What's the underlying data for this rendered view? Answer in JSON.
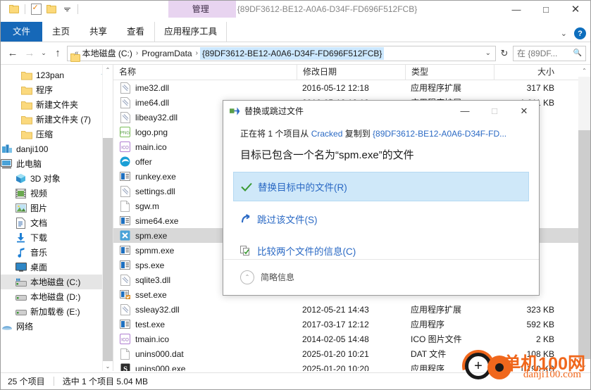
{
  "titlebar": {
    "window_title": "{89DF3612-BE12-A0A6-D34F-FD696F512FCB}",
    "context_tab": "管理",
    "quick_access": [
      {
        "name": "new-folder-icon",
        "label": ""
      },
      {
        "name": "properties-icon",
        "label": ""
      },
      {
        "name": "open-folder-icon",
        "label": ""
      },
      {
        "name": "customize-qat-icon",
        "label": ""
      }
    ],
    "minimize": "—",
    "maximize": "□",
    "close": "✕"
  },
  "ribbon": {
    "tabs": [
      {
        "label": "文件",
        "active": true
      },
      {
        "label": "主页",
        "active": false
      },
      {
        "label": "共享",
        "active": false
      },
      {
        "label": "查看",
        "active": false
      },
      {
        "label": "应用程序工具",
        "active": false
      }
    ],
    "collapse_chevron": "⌄",
    "help_label": "?"
  },
  "address": {
    "back": "←",
    "forward": "→",
    "recent": "⌄",
    "up": "↑",
    "chevrons": "«",
    "crumbs": [
      {
        "label": "本地磁盘 (C:)",
        "selected": false
      },
      {
        "label": "ProgramData",
        "selected": false
      },
      {
        "label": "{89DF3612-BE12-A0A6-D34F-FD696F512FCB}",
        "selected": true
      }
    ],
    "dropdown": "⌄",
    "refresh": "↻",
    "search_placeholder": "在 {89DF...",
    "search_icon": "🔍"
  },
  "sidebar": {
    "items": [
      {
        "label": "123pan",
        "icon": "folder-icon",
        "indent": 1,
        "pinned": true,
        "selected": false
      },
      {
        "label": "程序",
        "icon": "folder-icon",
        "indent": 1,
        "pinned": false,
        "selected": false
      },
      {
        "label": "新建文件夹",
        "icon": "folder-icon",
        "indent": 1,
        "pinned": false,
        "selected": false
      },
      {
        "label": "新建文件夹 (7)",
        "icon": "folder-icon",
        "indent": 1,
        "pinned": false,
        "selected": false
      },
      {
        "label": "压缩",
        "icon": "folder-icon",
        "indent": 1,
        "pinned": false,
        "selected": false
      },
      {
        "label": "danji100",
        "icon": "onedrive-icon",
        "indent": 0,
        "pinned": false,
        "selected": false
      },
      {
        "label": "此电脑",
        "icon": "this-pc-icon",
        "indent": 0,
        "pinned": false,
        "selected": false
      },
      {
        "label": "3D 对象",
        "icon": "3d-objects-icon",
        "indent": 2,
        "pinned": false,
        "selected": false
      },
      {
        "label": "视频",
        "icon": "videos-icon",
        "indent": 2,
        "pinned": false,
        "selected": false
      },
      {
        "label": "图片",
        "icon": "pictures-icon",
        "indent": 2,
        "pinned": false,
        "selected": false
      },
      {
        "label": "文档",
        "icon": "documents-icon",
        "indent": 2,
        "pinned": false,
        "selected": false
      },
      {
        "label": "下载",
        "icon": "downloads-icon",
        "indent": 2,
        "pinned": false,
        "selected": false
      },
      {
        "label": "音乐",
        "icon": "music-icon",
        "indent": 2,
        "pinned": false,
        "selected": false
      },
      {
        "label": "桌面",
        "icon": "desktop-icon",
        "indent": 2,
        "pinned": false,
        "selected": false
      },
      {
        "label": "本地磁盘 (C:)",
        "icon": "system-drive-icon",
        "indent": 2,
        "pinned": false,
        "selected": true
      },
      {
        "label": "本地磁盘 (D:)",
        "icon": "drive-icon",
        "indent": 2,
        "pinned": false,
        "selected": false
      },
      {
        "label": "新加载卷 (E:)",
        "icon": "drive-icon",
        "indent": 2,
        "pinned": false,
        "selected": false
      },
      {
        "label": "网络",
        "icon": "network-icon",
        "indent": 0,
        "pinned": false,
        "selected": false
      }
    ],
    "scroll_up": "⌃",
    "scroll_down": "⌄"
  },
  "filelist": {
    "columns": [
      "名称",
      "修改日期",
      "类型",
      "大小"
    ],
    "sort_indicator": "⌃",
    "rows": [
      {
        "name": "ime32.dll",
        "icon": "dll-icon",
        "date": "2016-05-12 12:18",
        "type": "应用程序扩展",
        "size": "317 KB",
        "selected": false
      },
      {
        "name": "ime64.dll",
        "icon": "dll-icon",
        "date": "2016-05-12 12:18",
        "type": "应用程序扩展",
        "size": "1,611 KB",
        "selected": false
      },
      {
        "name": "libeay32.dll",
        "icon": "dll-icon",
        "date": "",
        "type": "",
        "size": "",
        "selected": false
      },
      {
        "name": "logo.png",
        "icon": "png-icon",
        "date": "",
        "type": "",
        "size": "",
        "selected": false
      },
      {
        "name": "main.ico",
        "icon": "ico-icon",
        "date": "",
        "type": "",
        "size": "",
        "selected": false
      },
      {
        "name": "offer",
        "icon": "edge-icon",
        "date": "",
        "type": "",
        "size": "",
        "selected": false
      },
      {
        "name": "runkey.exe",
        "icon": "exe-icon",
        "date": "",
        "type": "",
        "size": "",
        "selected": false
      },
      {
        "name": "settings.dll",
        "icon": "dll-icon",
        "date": "",
        "type": "",
        "size": "",
        "selected": false
      },
      {
        "name": "sgw.m",
        "icon": "file-icon",
        "date": "",
        "type": "",
        "size": "",
        "selected": false
      },
      {
        "name": "sime64.exe",
        "icon": "exe-icon",
        "date": "",
        "type": "",
        "size": "",
        "selected": false
      },
      {
        "name": "spm.exe",
        "icon": "app-x-icon",
        "date": "",
        "type": "",
        "size": "",
        "selected": true
      },
      {
        "name": "spmm.exe",
        "icon": "exe-icon",
        "date": "",
        "type": "",
        "size": "",
        "selected": false
      },
      {
        "name": "sps.exe",
        "icon": "exe-icon",
        "date": "",
        "type": "",
        "size": "",
        "selected": false
      },
      {
        "name": "sqlite3.dll",
        "icon": "dll-icon",
        "date": "",
        "type": "",
        "size": "",
        "selected": false
      },
      {
        "name": "sset.exe",
        "icon": "sset-icon",
        "date": "",
        "type": "",
        "size": "",
        "selected": false
      },
      {
        "name": "ssleay32.dll",
        "icon": "dll-icon",
        "date": "2012-05-21 14:43",
        "type": "应用程序扩展",
        "size": "323 KB",
        "selected": false
      },
      {
        "name": "test.exe",
        "icon": "exe-icon",
        "date": "2017-03-17 12:12",
        "type": "应用程序",
        "size": "592 KB",
        "selected": false
      },
      {
        "name": "tmain.ico",
        "icon": "ico-icon",
        "date": "2014-02-05 14:48",
        "type": "ICO 图片文件",
        "size": "2 KB",
        "selected": false
      },
      {
        "name": "unins000.dat",
        "icon": "file-icon",
        "date": "2025-01-20 10:21",
        "type": "DAT 文件",
        "size": "108 KB",
        "selected": false
      },
      {
        "name": "unins000.exe",
        "icon": "setup-icon",
        "date": "2025-01-20 10:20",
        "type": "应用程序",
        "size": "1,190 KB",
        "selected": false
      }
    ],
    "scroll_up": "⌃",
    "scroll_down": "⌄"
  },
  "statusbar": {
    "item_count": "25 个项目",
    "selection": "选中 1 个项目  5.04 MB"
  },
  "dialog": {
    "title": "替换或跳过文件",
    "icon": "copy-files-icon",
    "minimize": "—",
    "maximize": "□",
    "close": "✕",
    "line_prefix": "正在将 1 个项目从 ",
    "source": "Cracked",
    "line_middle": " 复制到 ",
    "destination": "{89DF3612-BE12-A0A6-D34F-FD...",
    "question": "目标已包含一个名为“spm.exe”的文件",
    "options": [
      {
        "label": "替换目标中的文件(R)",
        "icon": "check-icon",
        "highlighted": true
      },
      {
        "label": "跳过该文件(S)",
        "icon": "skip-arrow-icon",
        "highlighted": false
      },
      {
        "label": "比较两个文件的信息(C)",
        "icon": "compare-files-icon",
        "highlighted": false
      }
    ],
    "details_label": "简略信息",
    "details_chevron": "⌃"
  },
  "watermark": {
    "title": "单机100网",
    "subtitle": "danji100.com",
    "plus": "+"
  },
  "colors": {
    "accent_blue": "#1668b8",
    "link_blue": "#2a69c4",
    "highlight": "#cfe8f9",
    "selection": "#d8d8d8",
    "context_tab": "#e8d4f0",
    "watermark_orange": "#f0671c"
  }
}
